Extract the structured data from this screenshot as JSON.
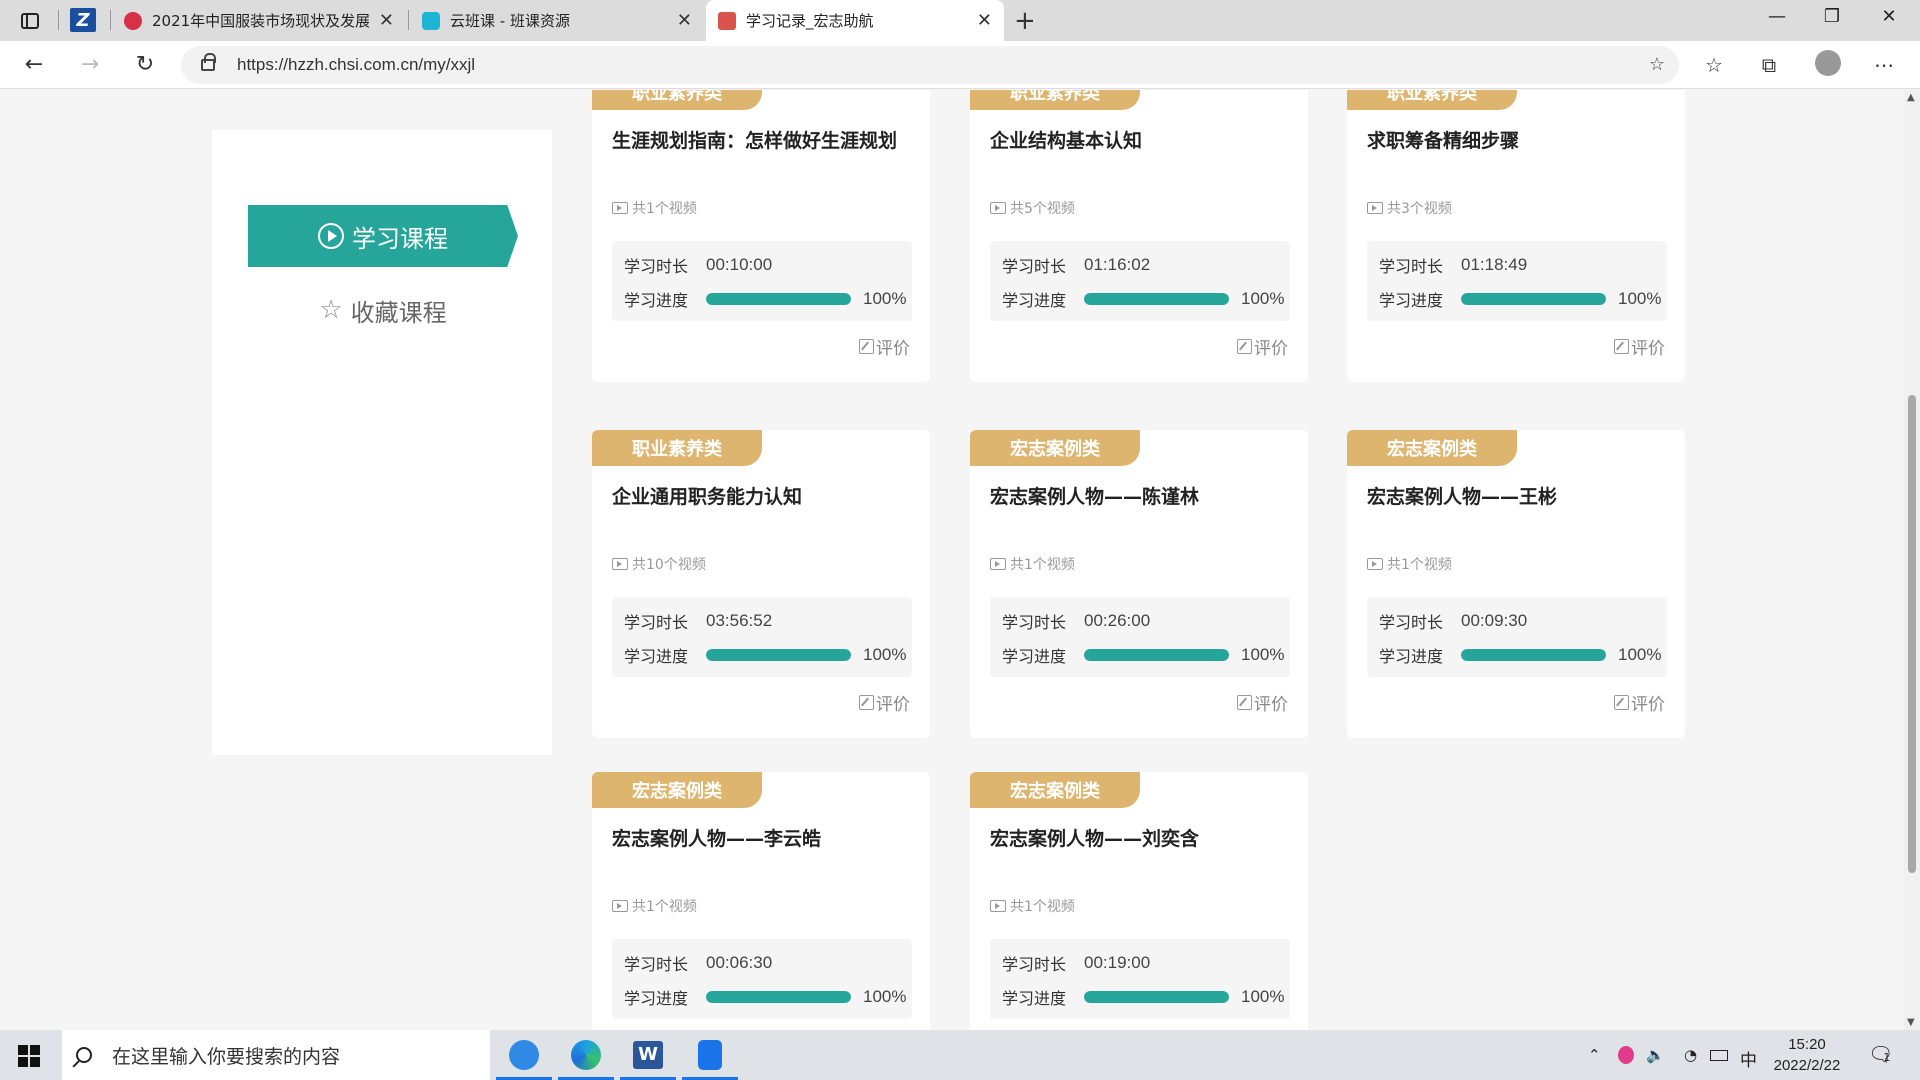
{
  "browser": {
    "tabs": [
      {
        "title": "2021年中国服装市场现状及发展",
        "favicon_color": "#d9304a"
      },
      {
        "title": "云班课 - 班课资源",
        "favicon_color": "#1cb5d5"
      },
      {
        "title": "学习记录_宏志助航",
        "favicon_color": "#d9534f",
        "active": true
      }
    ],
    "pinned_label": "Z",
    "url": "https://hzzh.chsi.com.cn/my/xxjl"
  },
  "sidebar": {
    "active_item": "学习课程",
    "other_item": "收藏课程"
  },
  "card_labels": {
    "duration": "学习时长",
    "progress": "学习进度",
    "rate": "评价"
  },
  "courses": [
    {
      "category": "职业素养类",
      "title": "生涯规划指南：怎样做好生涯规划",
      "videos": "共1个视频",
      "duration": "00:10:00",
      "progress": 100,
      "progress_text": "100%"
    },
    {
      "category": "职业素养类",
      "title": "企业结构基本认知",
      "videos": "共5个视频",
      "duration": "01:16:02",
      "progress": 100,
      "progress_text": "100%"
    },
    {
      "category": "职业素养类",
      "title": "求职筹备精细步骤",
      "videos": "共3个视频",
      "duration": "01:18:49",
      "progress": 100,
      "progress_text": "100%"
    },
    {
      "category": "职业素养类",
      "title": "企业通用职务能力认知",
      "videos": "共10个视频",
      "duration": "03:56:52",
      "progress": 100,
      "progress_text": "100%"
    },
    {
      "category": "宏志案例类",
      "title": "宏志案例人物——陈谨林",
      "videos": "共1个视频",
      "duration": "00:26:00",
      "progress": 100,
      "progress_text": "100%"
    },
    {
      "category": "宏志案例类",
      "title": "宏志案例人物——王彬",
      "videos": "共1个视频",
      "duration": "00:09:30",
      "progress": 100,
      "progress_text": "100%"
    },
    {
      "category": "宏志案例类",
      "title": "宏志案例人物——李云皓",
      "videos": "共1个视频",
      "duration": "00:06:30",
      "progress": 100,
      "progress_text": "100%"
    },
    {
      "category": "宏志案例类",
      "title": "宏志案例人物——刘奕含",
      "videos": "共1个视频",
      "duration": "00:19:00",
      "progress": 100,
      "progress_text": "100%"
    }
  ],
  "colors": {
    "accent": "#26a69a",
    "category_badge": "#ddb56e"
  },
  "taskbar": {
    "search_placeholder": "在这里输入你要搜索的内容",
    "ime": "中",
    "time": "15:20",
    "date": "2022/2/22",
    "notification_count": "1"
  }
}
